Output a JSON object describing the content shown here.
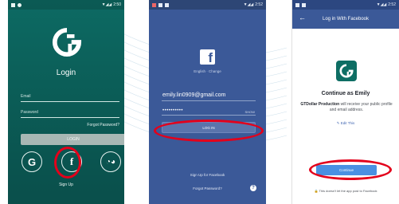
{
  "screen1": {
    "status_time": "2:50",
    "title": "Login",
    "email_label": "Email",
    "password_label": "Password",
    "forgot_password": "Forgot Password?",
    "login_button": "LOGIN",
    "google_icon": "google-icon",
    "facebook_icon": "facebook-icon",
    "wechat_icon": "wechat-icon",
    "sign_up": "Sign Up",
    "colors": {
      "background": "#0b5d57"
    }
  },
  "screen2": {
    "status_time": "2:52",
    "language": "English · Change",
    "email_value": "emily.lin0909@gmail.com",
    "password_value": "••••••••••",
    "show_label": "SHOW",
    "login_button": "LOG IN",
    "sign_up": "Sign Up for Facebook",
    "forgot_password": "Forgot Password?",
    "help_icon": "?",
    "colors": {
      "background": "#3b5998"
    }
  },
  "screen3": {
    "status_time": "2:52",
    "header_title": "Log in With Facebook",
    "continue_as": "Continue as Emily",
    "app_name": "GTDollar Production",
    "description_rest": "will receive your public profile and email address.",
    "edit_this": "Edit This",
    "continue_button": "Continue",
    "notice": "This doesn't let the app post to Facebook",
    "colors": {
      "header": "#3b5998",
      "button": "#4a90e2"
    }
  },
  "highlight_color": "#e3001b"
}
